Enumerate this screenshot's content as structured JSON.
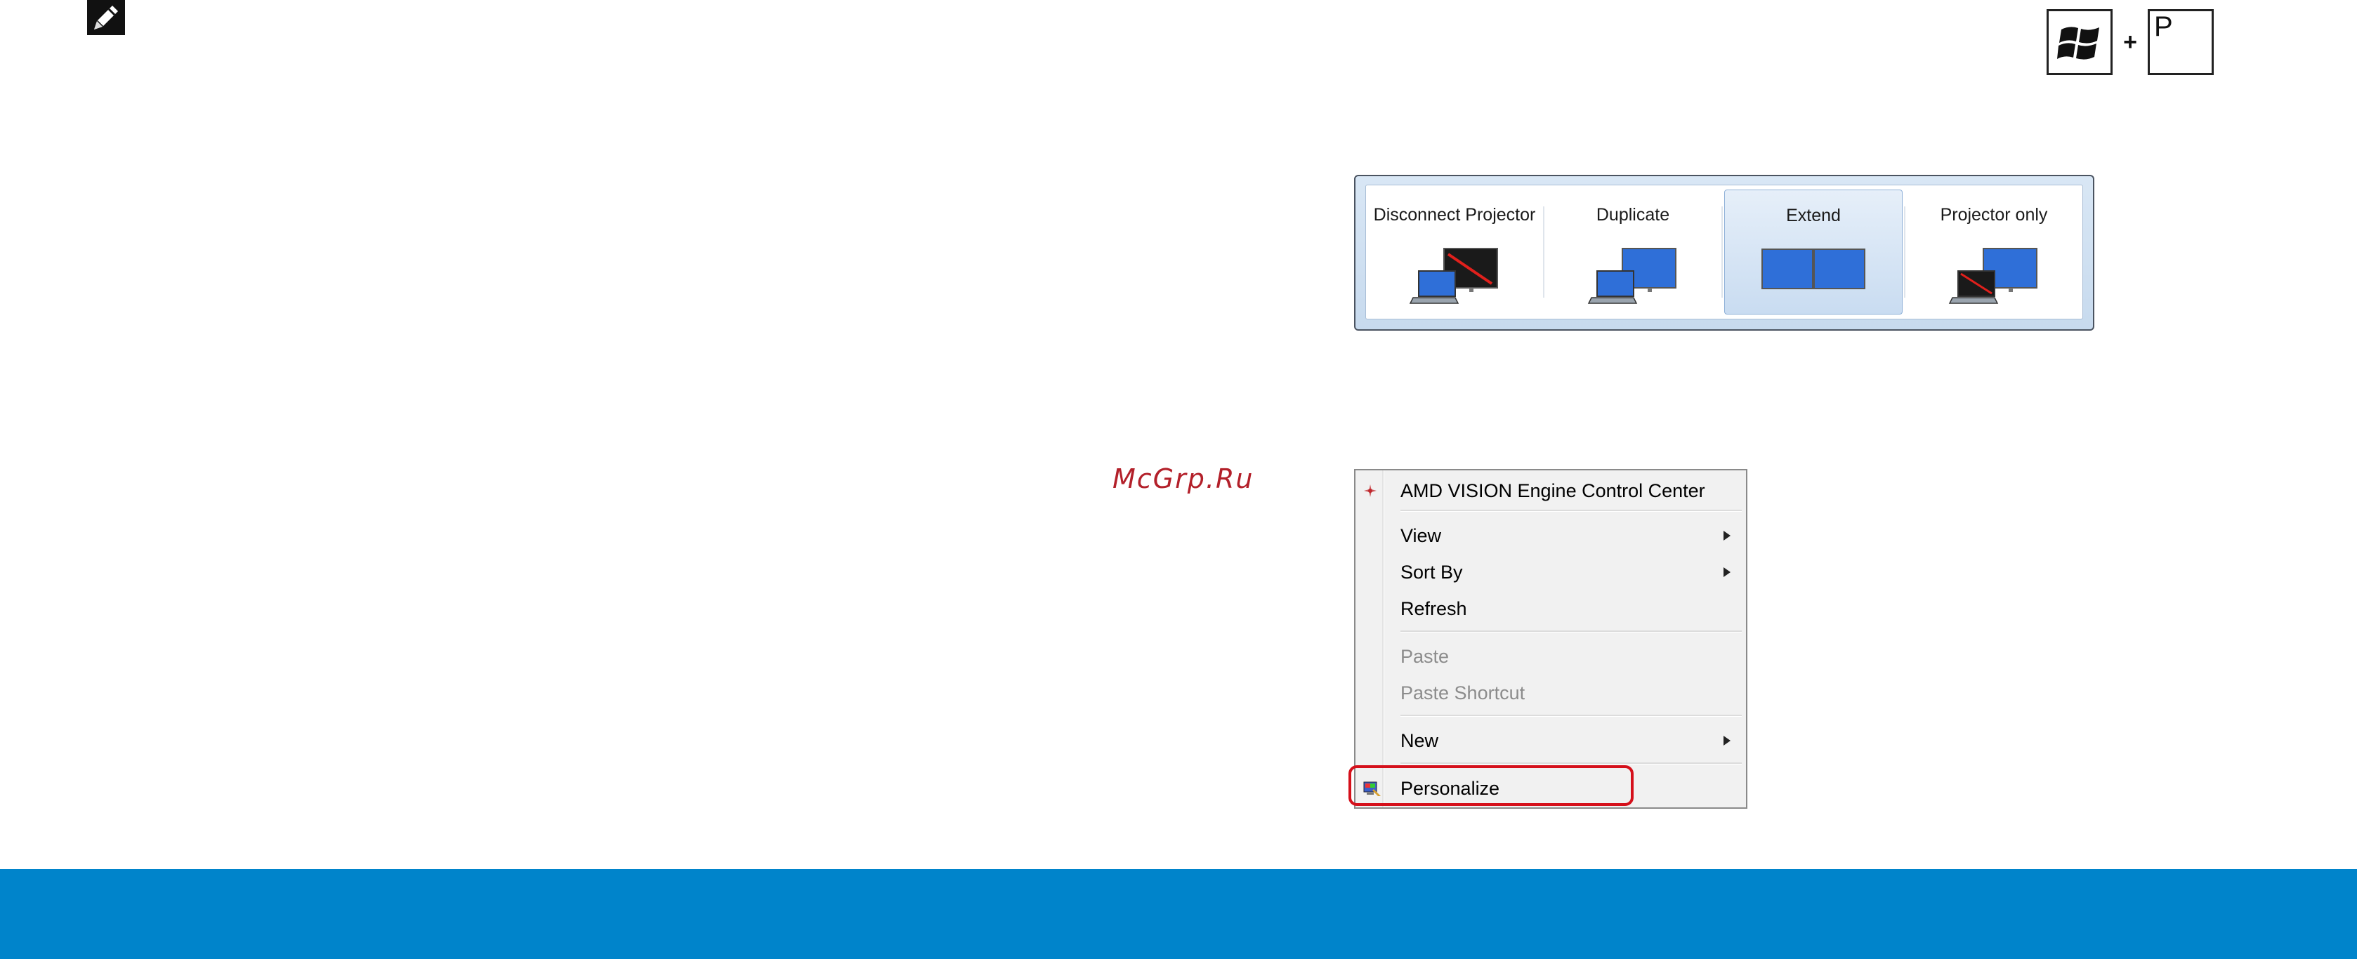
{
  "shortcut": {
    "plus": "+",
    "letter_key": "P"
  },
  "projector_switcher": {
    "options": [
      {
        "label": "Disconnect Projector",
        "selected": false
      },
      {
        "label": "Duplicate",
        "selected": false
      },
      {
        "label": "Extend",
        "selected": true
      },
      {
        "label": "Projector only",
        "selected": false
      }
    ]
  },
  "watermark": "McGrp.Ru",
  "context_menu": {
    "items": [
      {
        "label": "AMD VISION Engine Control Center",
        "icon": "amd-icon",
        "submenu": false,
        "enabled": true
      },
      {
        "label": "View",
        "submenu": true,
        "enabled": true
      },
      {
        "label": "Sort By",
        "submenu": true,
        "enabled": true
      },
      {
        "label": "Refresh",
        "submenu": false,
        "enabled": true
      },
      {
        "label": "Paste",
        "submenu": false,
        "enabled": false
      },
      {
        "label": "Paste Shortcut",
        "submenu": false,
        "enabled": false
      },
      {
        "label": "New",
        "submenu": true,
        "enabled": true
      },
      {
        "label": "Personalize",
        "icon": "personalize-icon",
        "submenu": false,
        "enabled": true,
        "highlighted": true
      }
    ]
  },
  "colors": {
    "footer_band": "#0084cb",
    "highlight": "#d5101b",
    "monitor_blue": "#2f6fd8"
  }
}
